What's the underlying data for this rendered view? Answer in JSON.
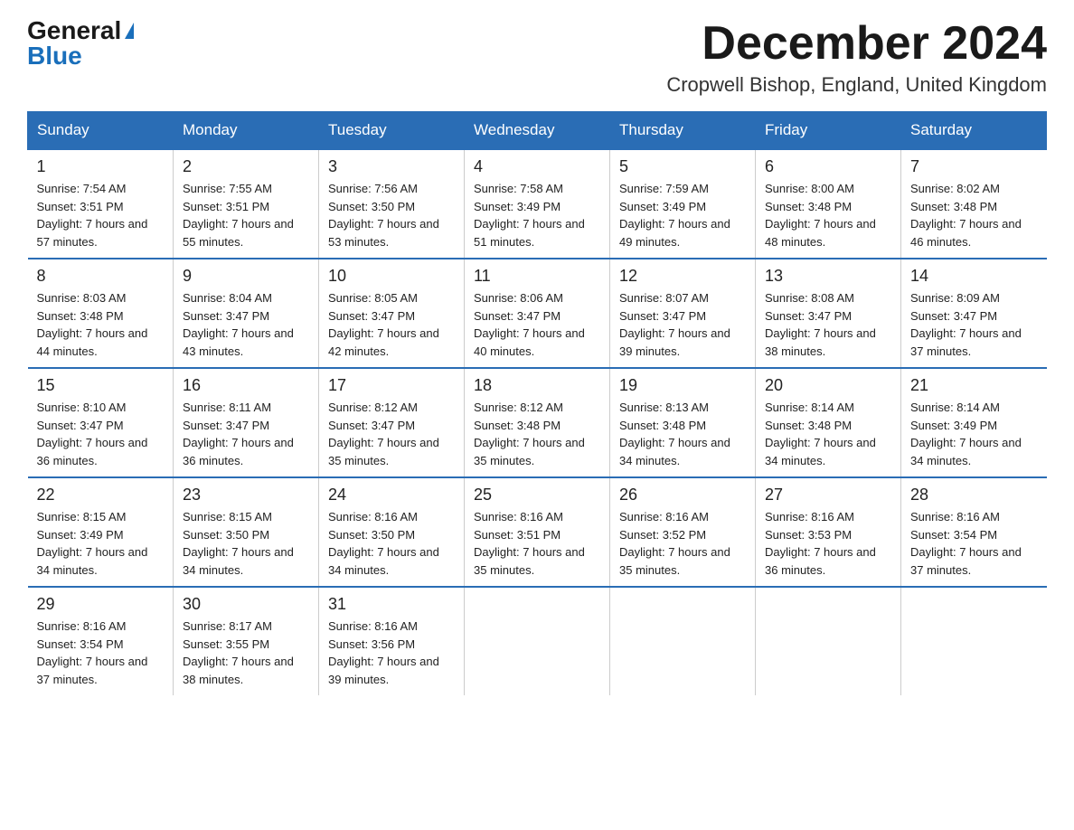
{
  "logo": {
    "general": "General",
    "blue": "Blue"
  },
  "title": "December 2024",
  "location": "Cropwell Bishop, England, United Kingdom",
  "headers": [
    "Sunday",
    "Monday",
    "Tuesday",
    "Wednesday",
    "Thursday",
    "Friday",
    "Saturday"
  ],
  "weeks": [
    [
      {
        "day": "1",
        "sunrise": "7:54 AM",
        "sunset": "3:51 PM",
        "daylight": "7 hours and 57 minutes."
      },
      {
        "day": "2",
        "sunrise": "7:55 AM",
        "sunset": "3:51 PM",
        "daylight": "7 hours and 55 minutes."
      },
      {
        "day": "3",
        "sunrise": "7:56 AM",
        "sunset": "3:50 PM",
        "daylight": "7 hours and 53 minutes."
      },
      {
        "day": "4",
        "sunrise": "7:58 AM",
        "sunset": "3:49 PM",
        "daylight": "7 hours and 51 minutes."
      },
      {
        "day": "5",
        "sunrise": "7:59 AM",
        "sunset": "3:49 PM",
        "daylight": "7 hours and 49 minutes."
      },
      {
        "day": "6",
        "sunrise": "8:00 AM",
        "sunset": "3:48 PM",
        "daylight": "7 hours and 48 minutes."
      },
      {
        "day": "7",
        "sunrise": "8:02 AM",
        "sunset": "3:48 PM",
        "daylight": "7 hours and 46 minutes."
      }
    ],
    [
      {
        "day": "8",
        "sunrise": "8:03 AM",
        "sunset": "3:48 PM",
        "daylight": "7 hours and 44 minutes."
      },
      {
        "day": "9",
        "sunrise": "8:04 AM",
        "sunset": "3:47 PM",
        "daylight": "7 hours and 43 minutes."
      },
      {
        "day": "10",
        "sunrise": "8:05 AM",
        "sunset": "3:47 PM",
        "daylight": "7 hours and 42 minutes."
      },
      {
        "day": "11",
        "sunrise": "8:06 AM",
        "sunset": "3:47 PM",
        "daylight": "7 hours and 40 minutes."
      },
      {
        "day": "12",
        "sunrise": "8:07 AM",
        "sunset": "3:47 PM",
        "daylight": "7 hours and 39 minutes."
      },
      {
        "day": "13",
        "sunrise": "8:08 AM",
        "sunset": "3:47 PM",
        "daylight": "7 hours and 38 minutes."
      },
      {
        "day": "14",
        "sunrise": "8:09 AM",
        "sunset": "3:47 PM",
        "daylight": "7 hours and 37 minutes."
      }
    ],
    [
      {
        "day": "15",
        "sunrise": "8:10 AM",
        "sunset": "3:47 PM",
        "daylight": "7 hours and 36 minutes."
      },
      {
        "day": "16",
        "sunrise": "8:11 AM",
        "sunset": "3:47 PM",
        "daylight": "7 hours and 36 minutes."
      },
      {
        "day": "17",
        "sunrise": "8:12 AM",
        "sunset": "3:47 PM",
        "daylight": "7 hours and 35 minutes."
      },
      {
        "day": "18",
        "sunrise": "8:12 AM",
        "sunset": "3:48 PM",
        "daylight": "7 hours and 35 minutes."
      },
      {
        "day": "19",
        "sunrise": "8:13 AM",
        "sunset": "3:48 PM",
        "daylight": "7 hours and 34 minutes."
      },
      {
        "day": "20",
        "sunrise": "8:14 AM",
        "sunset": "3:48 PM",
        "daylight": "7 hours and 34 minutes."
      },
      {
        "day": "21",
        "sunrise": "8:14 AM",
        "sunset": "3:49 PM",
        "daylight": "7 hours and 34 minutes."
      }
    ],
    [
      {
        "day": "22",
        "sunrise": "8:15 AM",
        "sunset": "3:49 PM",
        "daylight": "7 hours and 34 minutes."
      },
      {
        "day": "23",
        "sunrise": "8:15 AM",
        "sunset": "3:50 PM",
        "daylight": "7 hours and 34 minutes."
      },
      {
        "day": "24",
        "sunrise": "8:16 AM",
        "sunset": "3:50 PM",
        "daylight": "7 hours and 34 minutes."
      },
      {
        "day": "25",
        "sunrise": "8:16 AM",
        "sunset": "3:51 PM",
        "daylight": "7 hours and 35 minutes."
      },
      {
        "day": "26",
        "sunrise": "8:16 AM",
        "sunset": "3:52 PM",
        "daylight": "7 hours and 35 minutes."
      },
      {
        "day": "27",
        "sunrise": "8:16 AM",
        "sunset": "3:53 PM",
        "daylight": "7 hours and 36 minutes."
      },
      {
        "day": "28",
        "sunrise": "8:16 AM",
        "sunset": "3:54 PM",
        "daylight": "7 hours and 37 minutes."
      }
    ],
    [
      {
        "day": "29",
        "sunrise": "8:16 AM",
        "sunset": "3:54 PM",
        "daylight": "7 hours and 37 minutes."
      },
      {
        "day": "30",
        "sunrise": "8:17 AM",
        "sunset": "3:55 PM",
        "daylight": "7 hours and 38 minutes."
      },
      {
        "day": "31",
        "sunrise": "8:16 AM",
        "sunset": "3:56 PM",
        "daylight": "7 hours and 39 minutes."
      },
      null,
      null,
      null,
      null
    ]
  ]
}
